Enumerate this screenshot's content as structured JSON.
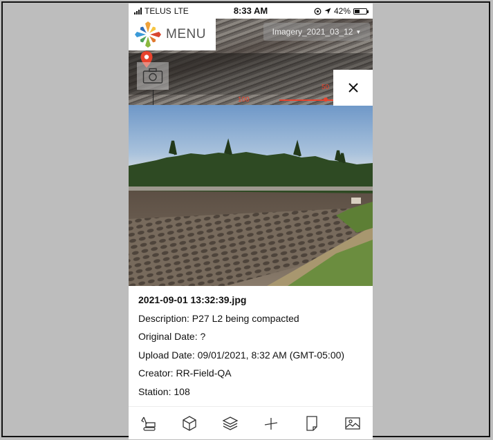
{
  "status_bar": {
    "carrier": "TELUS",
    "network": "LTE",
    "time": "8:33 AM",
    "battery": "42%",
    "battery_level": 0.42
  },
  "map": {
    "menu_label": "MENU",
    "imagery_layer": "Imagery_2021_03_12",
    "scale_labels": [
      "100",
      "50"
    ]
  },
  "photo": {
    "filename": "2021-09-01 13:32:39.jpg",
    "description": "Description: P27 L2 being compacted",
    "original_date": "Original Date: ?",
    "upload_date": "Upload Date: 09/01/2021, 8:32 AM (GMT-05:00)",
    "creator": "Creator: RR-Field-QA",
    "station": "Station: 108"
  },
  "toolbar": {
    "items": [
      "excavator-icon",
      "box-3d-icon",
      "layers-icon",
      "measure-icon",
      "document-icon",
      "image-icon"
    ]
  },
  "colors": {
    "accent": "#e8432d",
    "background": "#bdbdbd"
  }
}
